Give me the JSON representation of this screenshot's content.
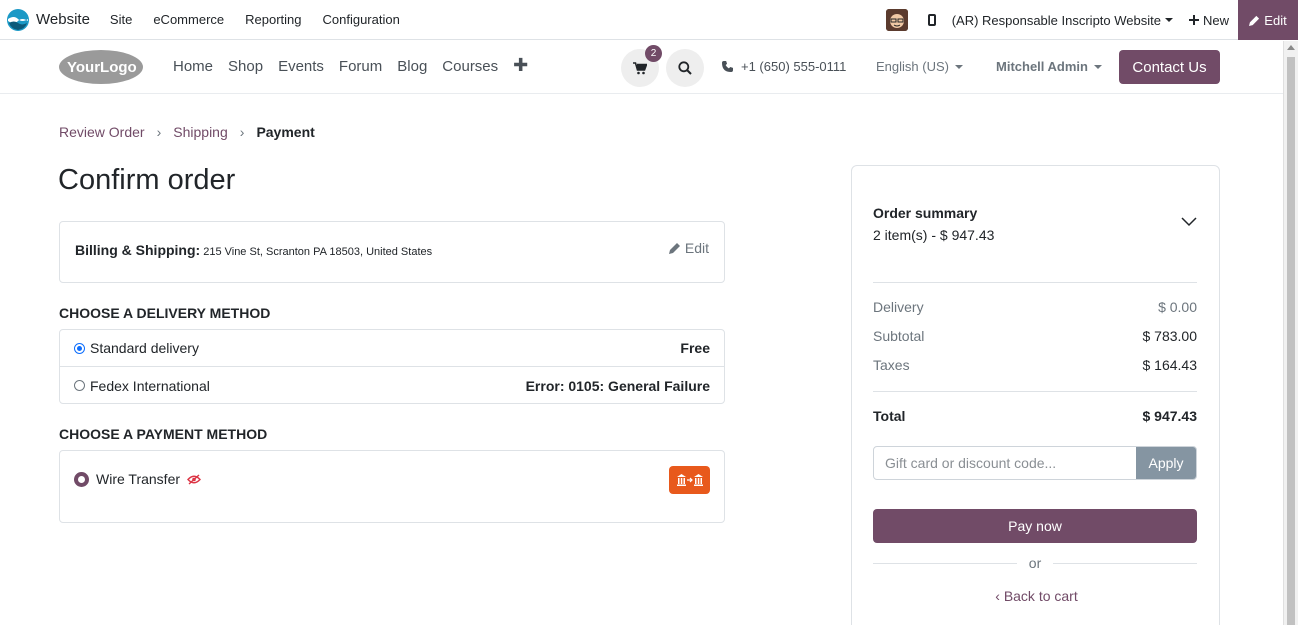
{
  "adminbar": {
    "app_name": "Website",
    "menus": [
      "Site",
      "eCommerce",
      "Reporting",
      "Configuration"
    ],
    "company": "(AR) Responsable Inscripto Website",
    "new_label": "New",
    "edit_label": "Edit"
  },
  "header": {
    "logo_text": "YourLogo",
    "nav": [
      "Home",
      "Shop",
      "Events",
      "Forum",
      "Blog",
      "Courses"
    ],
    "cart_count": "2",
    "phone": "+1 (650) 555-0111",
    "language": "English (US)",
    "user": "Mitchell Admin",
    "contact_label": "Contact Us"
  },
  "breadcrumb": {
    "steps": [
      "Review Order",
      "Shipping",
      "Payment"
    ]
  },
  "page_title": "Confirm order",
  "address": {
    "label": "Billing & Shipping:",
    "value": "215 Vine St, Scranton PA 18503, United States",
    "edit_label": "Edit"
  },
  "delivery": {
    "title": "CHOOSE A DELIVERY METHOD",
    "methods": [
      {
        "name": "Standard delivery",
        "price": "Free",
        "selected": true
      },
      {
        "name": "Fedex International",
        "price": "Error: 0105: General Failure",
        "selected": false
      }
    ]
  },
  "payment": {
    "title": "CHOOSE A PAYMENT METHOD",
    "method": "Wire Transfer"
  },
  "summary": {
    "title": "Order summary",
    "items": "2 item(s) -  $ 947.43",
    "delivery_label": "Delivery",
    "delivery_value": "$ 0.00",
    "subtotal_label": "Subtotal",
    "subtotal_value": "$ 783.00",
    "taxes_label": "Taxes",
    "taxes_value": "$ 164.43",
    "total_label": "Total",
    "total_value": "$ 947.43",
    "discount_placeholder": "Gift card or discount code...",
    "apply_label": "Apply",
    "pay_label": "Pay now",
    "or_label": "or",
    "back_label": "Back to cart"
  },
  "colors": {
    "brand": "#714b67",
    "selected_radio": "#0d6efd",
    "payment_icon": "#e8591c"
  }
}
